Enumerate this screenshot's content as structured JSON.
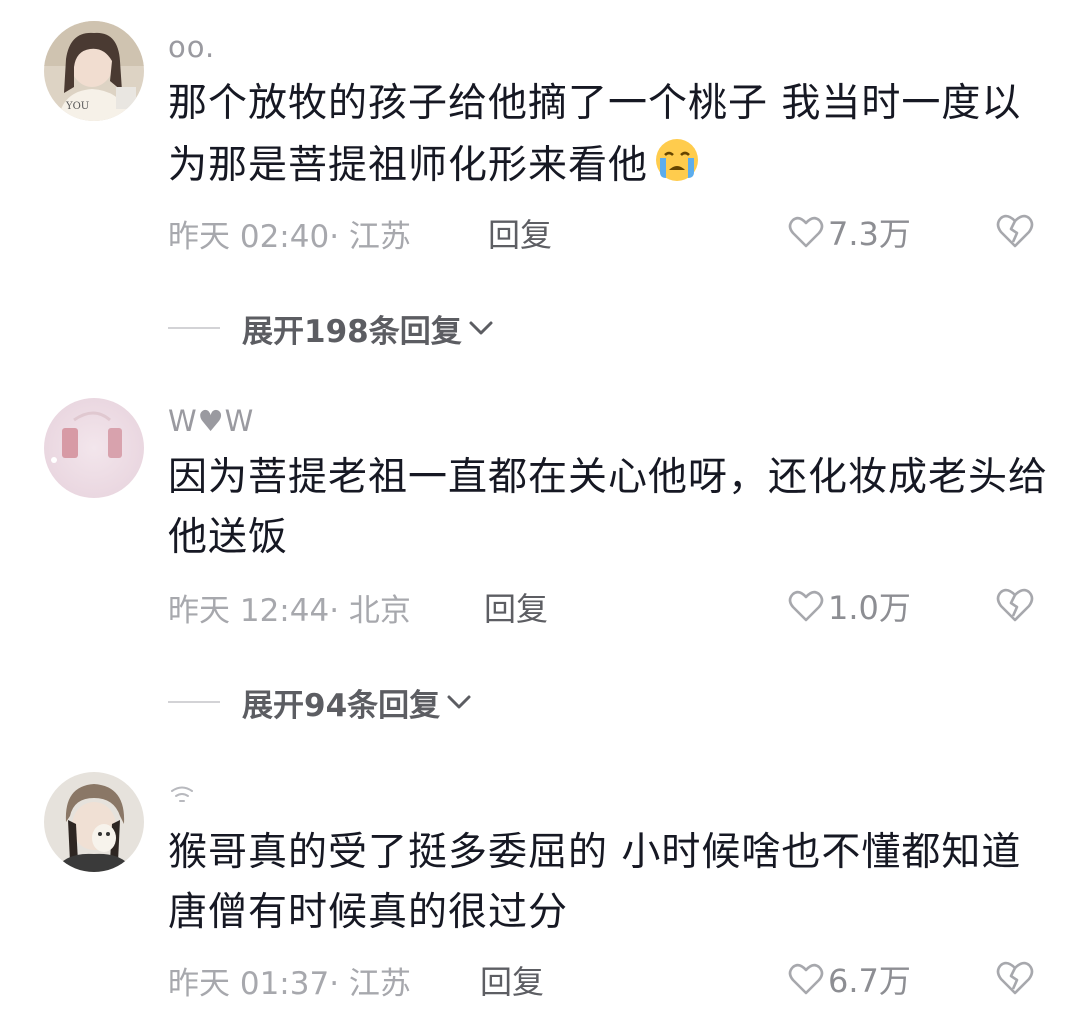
{
  "comments": [
    {
      "username": "oo.",
      "text": "那个放牧的孩子给他摘了一个桃子 我当时一度以为那是菩提祖师化形来看他",
      "emoji": "crying-face-icon",
      "time": "昨天 02:40",
      "location": "江苏",
      "reply_label": "回复",
      "likes": "7.3万",
      "expand_label": "展开198条回复"
    },
    {
      "username": "W♥W",
      "text": "因为菩提老祖一直都在关心他呀，还化妆成老头给他送饭",
      "time": "昨天 12:44",
      "location": "北京",
      "reply_label": "回复",
      "likes": "1.0万",
      "expand_label": "展开94条回复"
    },
    {
      "username": "",
      "text": "猴哥真的受了挺多委屈的  小时候啥也不懂都知道唐僧有时候真的很过分",
      "time": "昨天 01:37",
      "location": "江苏",
      "reply_label": "回复",
      "likes": "6.7万"
    }
  ],
  "colors": {
    "text": "#161823",
    "meta": "#a7a8ad",
    "username": "#9a9aa0",
    "reply": "#5d5e63"
  },
  "icons": [
    "heart-outline-icon",
    "broken-heart-icon",
    "chevron-down-icon",
    "wifi-icon"
  ]
}
